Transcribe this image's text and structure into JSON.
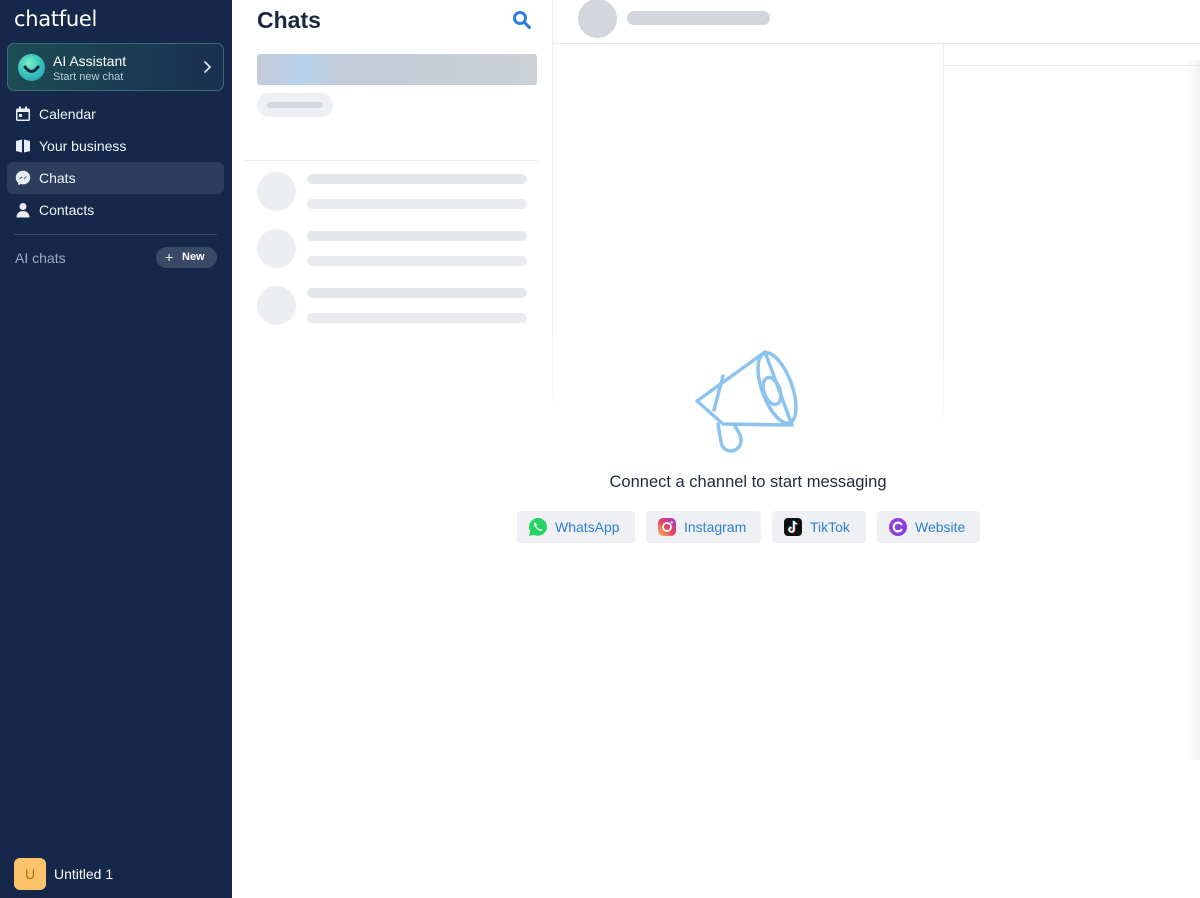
{
  "brand": {
    "name": "chatfuel"
  },
  "ai_assistant": {
    "title": "AI Assistant",
    "subtitle": "Start new chat"
  },
  "nav": {
    "items": [
      {
        "label": "Calendar",
        "icon": "calendar-icon"
      },
      {
        "label": "Your business",
        "icon": "book-icon"
      },
      {
        "label": "Chats",
        "icon": "messenger-icon",
        "active": true
      },
      {
        "label": "Contacts",
        "icon": "person-icon"
      }
    ]
  },
  "ai_chats": {
    "label": "AI chats",
    "new_label": "New"
  },
  "user": {
    "initial": "U",
    "name": "Untitled 1"
  },
  "chats": {
    "title": "Chats"
  },
  "empty_state": {
    "message": "Connect a channel to start messaging",
    "channels": [
      {
        "label": "WhatsApp",
        "icon": "whatsapp-icon",
        "color": "#25d366"
      },
      {
        "label": "Instagram",
        "icon": "instagram-icon",
        "color": "#e4405f"
      },
      {
        "label": "TikTok",
        "icon": "tiktok-icon",
        "color": "#111111"
      },
      {
        "label": "Website",
        "icon": "website-icon",
        "color": "#8b3fe0"
      }
    ]
  },
  "colors": {
    "sidebar_bg": "#16284a",
    "accent": "#2f7fd6",
    "active_nav": "#2d3d5c"
  }
}
